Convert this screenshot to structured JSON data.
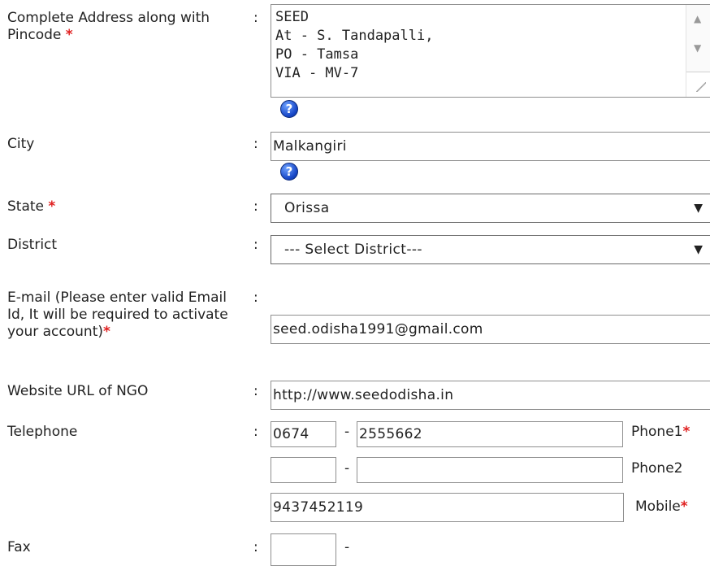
{
  "address": {
    "label": "Complete Address along with Pincode",
    "required_mark": "*",
    "colon": ":",
    "value": "SEED\nAt - S. Tandapalli,\nPO - Tamsa\nVIA - MV-7"
  },
  "city": {
    "label": "City",
    "colon": ":",
    "value": "Malkangiri"
  },
  "state": {
    "label": "State",
    "required_mark": "*",
    "colon": ":",
    "selected": "Orissa",
    "arrow": "▼"
  },
  "district": {
    "label": "District",
    "colon": ":",
    "selected": "--- Select District---",
    "arrow": "▼"
  },
  "email": {
    "label": "E-mail (Please enter valid Email Id, It will be required to activate your account)",
    "required_mark": "*",
    "colon": ":",
    "value": "seed.odisha1991@gmail.com"
  },
  "website": {
    "label": "Website URL of NGO",
    "colon": ":",
    "value": "http://www.seedodisha.in"
  },
  "telephone": {
    "label": "Telephone",
    "colon": ":",
    "dash": "-",
    "phone1": {
      "code": "0674",
      "number": "2555662",
      "label": "Phone1",
      "required_mark": "*"
    },
    "phone2": {
      "code": "",
      "number": "",
      "label": "Phone2"
    },
    "mobile": {
      "number": "9437452119",
      "label": "Mobile",
      "required_mark": "*"
    }
  },
  "fax": {
    "label": "Fax",
    "colon": ":",
    "dash": "-",
    "code": ""
  },
  "help_icon_glyph": "?",
  "scroll_up_glyph": "▲",
  "scroll_down_glyph": "▼"
}
